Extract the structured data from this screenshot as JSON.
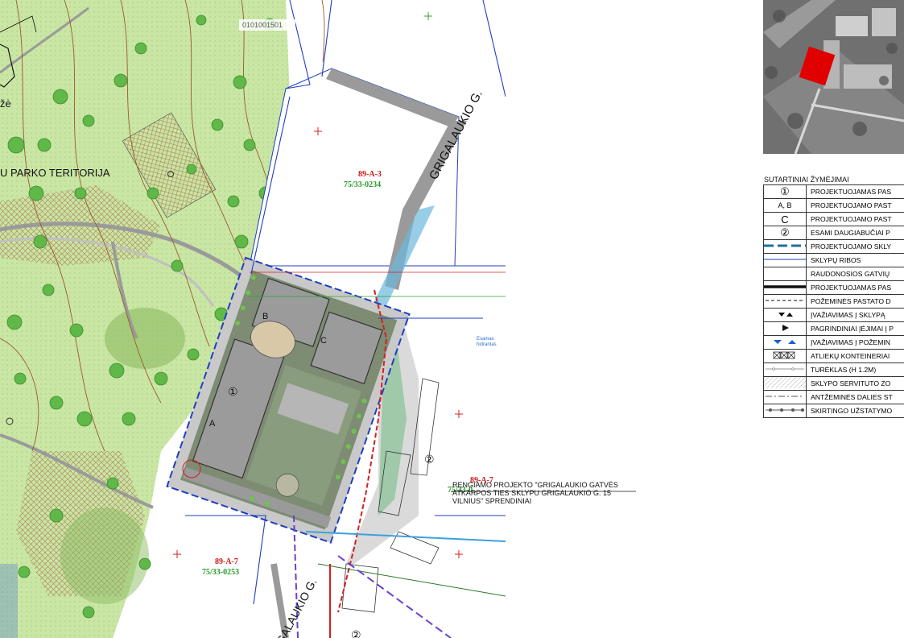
{
  "map_labels": {
    "park_territory": "U PARKO TERITORIJA",
    "park_partial": "žė",
    "parcel_top_id": "0101001501",
    "street_name_north": "GRIGALAUKIO G.",
    "street_name_south": "GALAUKIO G.",
    "building_a": "A",
    "building_b": "B",
    "building_c": "C",
    "circle_1": "①",
    "circle_2": "②",
    "circle_2_bottom": "②",
    "esamas_label": "Esamas\nhidrantas"
  },
  "parcels": [
    {
      "code": "89-A-3",
      "cadastral": "75/33-0234"
    },
    {
      "code": "89-A-7",
      "cadastral": "75/33-0253"
    },
    {
      "code": "89-A-7",
      "cadastral": "75/33-0"
    }
  ],
  "note": {
    "text_line1": "RENGIAMO PROJEKTO \"GRIGALAUKIO GATVĖS",
    "text_line2": "ATKARPOS  TIES SKLYPU GRIGALAUKIO G. 15",
    "text_line3": "VILNIUS\" SPRENDINIAI"
  },
  "legend": {
    "title": "SUTARTINIAI ŽYMĖJIMAI",
    "items": [
      {
        "symbol": "①",
        "symbol_type": "text",
        "label": "PROJEKTUOJAMAS PAS"
      },
      {
        "symbol": "A, B",
        "symbol_type": "text",
        "label": "PROJEKTUOJAMO PAST"
      },
      {
        "symbol": "C",
        "symbol_type": "text",
        "label": "PROJEKTUOJAMO PAST"
      },
      {
        "symbol": "②",
        "symbol_type": "text",
        "label": "ESAMI DAUGIABUČIAI P"
      },
      {
        "symbol": "",
        "symbol_type": "blue-dashed-line",
        "label": "PROJEKTUOJAMO SKLY"
      },
      {
        "symbol": "",
        "symbol_type": "blue-thin-line",
        "label": "SKLYPŲ RIBOS"
      },
      {
        "symbol": "",
        "symbol_type": "empty",
        "label": "RAUDONOSIOS GATVIŲ"
      },
      {
        "symbol": "",
        "symbol_type": "thick-black-line",
        "label": "PROJEKTUOJAMAS PAS"
      },
      {
        "symbol": "",
        "symbol_type": "black-dashed-line",
        "label": "POŽEMINĖS PASTATO D"
      },
      {
        "symbol": "",
        "symbol_type": "entry-arrows",
        "label": "ĮVAŽIAVIMAS Į SKLYPĄ"
      },
      {
        "symbol": "",
        "symbol_type": "triangle-right",
        "label": "PAGRINDINIAI ĮĖJIMAI Į P"
      },
      {
        "symbol": "",
        "symbol_type": "blue-arrows",
        "label": "ĮVAŽIAVIMAS Į POŽEMIN"
      },
      {
        "symbol": "",
        "symbol_type": "container-x",
        "label": "ATLIEKŲ KONTEINERIAI"
      },
      {
        "symbol": "",
        "symbol_type": "railing",
        "label": "TURĖKLAS  (H 1.2M)"
      },
      {
        "symbol": "",
        "symbol_type": "hatch",
        "label": "SKLYPO SERVITUTO ZO"
      },
      {
        "symbol": "",
        "symbol_type": "dash-dot-line",
        "label": "ANTŽEMINĖS DALIES ST"
      },
      {
        "symbol": "",
        "symbol_type": "dot-line",
        "label": "SKIRTINGO UŽSTATYMO"
      }
    ]
  },
  "colors": {
    "park_green": "#c9e6a4",
    "tree_green": "#5fb848",
    "road_grey": "#9a9a9a",
    "parcel_blue": "#1f3fbf",
    "red_line": "#d32020",
    "contour_brown": "#9b5a2a",
    "highlight_red": "#e00000"
  },
  "icons": {
    "north_circle": "circle-icon",
    "plus_marker": "plus-icon"
  }
}
